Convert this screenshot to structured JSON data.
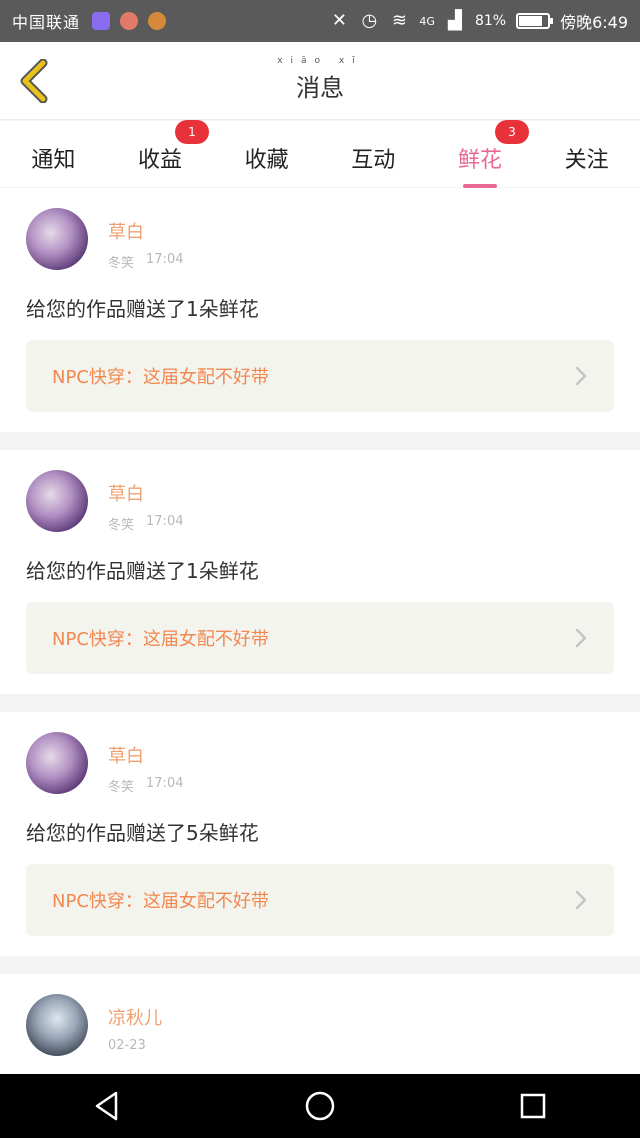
{
  "status_bar": {
    "carrier": "中国联通",
    "signal": "4G",
    "battery_percent": "81%",
    "battery_level": 0.81,
    "time": "傍晚6:49"
  },
  "header": {
    "title": "消息",
    "title_pinyin": "xiāo xī"
  },
  "tabs": [
    {
      "label": "通知",
      "badge": ""
    },
    {
      "label": "收益",
      "badge": "1"
    },
    {
      "label": "收藏",
      "badge": ""
    },
    {
      "label": "互动",
      "badge": ""
    },
    {
      "label": "鲜花",
      "badge": "3"
    },
    {
      "label": "关注",
      "badge": ""
    }
  ],
  "messages": [
    {
      "username": "草白",
      "role": "冬笑",
      "time": "17:04",
      "text": "给您的作品赠送了1朵鲜花",
      "work_title": "NPC快穿：这届女配不好带"
    },
    {
      "username": "草白",
      "role": "冬笑",
      "time": "17:04",
      "text": "给您的作品赠送了1朵鲜花",
      "work_title": "NPC快穿：这届女配不好带"
    },
    {
      "username": "草白",
      "role": "冬笑",
      "time": "17:04",
      "text": "给您的作品赠送了5朵鲜花",
      "work_title": "NPC快穿：这届女配不好带"
    },
    {
      "username": "凉秋儿",
      "role": "",
      "time": "02-23",
      "text": "",
      "work_title": ""
    }
  ],
  "icons": {
    "back": "chevron-left-icon",
    "work_arrow": "chevron-right-icon",
    "nav_back": "triangle-back-icon",
    "nav_home": "circle-home-icon",
    "nav_recent": "square-recent-icon"
  },
  "colors": {
    "accent": "#e86a92",
    "badge": "#e8323a",
    "username": "#f0a070",
    "work_title": "#f08850",
    "back_arrow": "#e8c21c"
  }
}
